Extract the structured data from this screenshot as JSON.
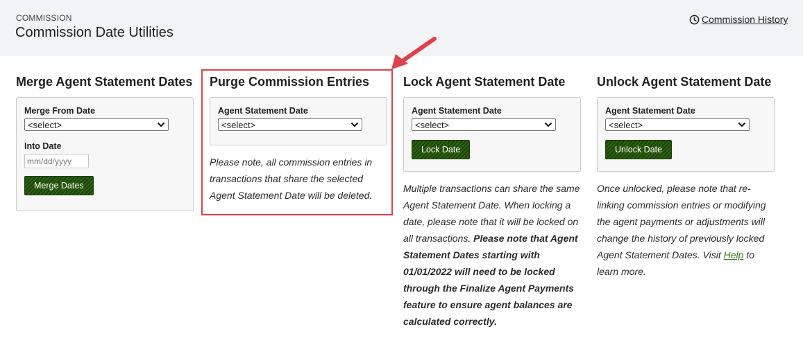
{
  "header": {
    "eyebrow": "COMMISSION",
    "title": "Commission Date Utilities",
    "history_link": "Commission History"
  },
  "merge": {
    "title": "Merge Agent Statement Dates",
    "from_label": "Merge From Date",
    "from_value": "<select>",
    "into_label": "Into Date",
    "into_placeholder": "mm/dd/yyyy",
    "button": "Merge Dates"
  },
  "purge": {
    "title": "Purge Commission Entries",
    "date_label": "Agent Statement Date",
    "date_value": "<select>",
    "note": "Please note, all commission entries in transactions that share the selected Agent Statement Date will be deleted."
  },
  "lock": {
    "title": "Lock Agent Statement Date",
    "date_label": "Agent Statement Date",
    "date_value": "<select>",
    "button": "Lock Date",
    "note_normal": "Multiple transactions can share the same Agent Statement Date. When locking a date, please note that it will be locked on all transactions. ",
    "note_bold": "Please note that Agent Statement Dates starting with 01/01/2022 will need to be locked through the Finalize Agent Payments feature to ensure agent balances are calculated correctly."
  },
  "unlock": {
    "title": "Unlock Agent Statement Date",
    "date_label": "Agent Statement Date",
    "date_value": "<select>",
    "button": "Unlock Date",
    "note_before": "Once unlocked, please note that re-linking commission entries or modifying the agent payments or adjustments will change the history of previously locked Agent Statement Dates. Visit ",
    "help_link": "Help",
    "note_after": " to learn more."
  },
  "colors": {
    "header_bg": "#f2f3f5",
    "button_green": "#2f6110",
    "highlight_red": "#e0404a"
  },
  "icons": [
    "clock-icon",
    "chevron-down-icon",
    "annotation-arrow"
  ]
}
